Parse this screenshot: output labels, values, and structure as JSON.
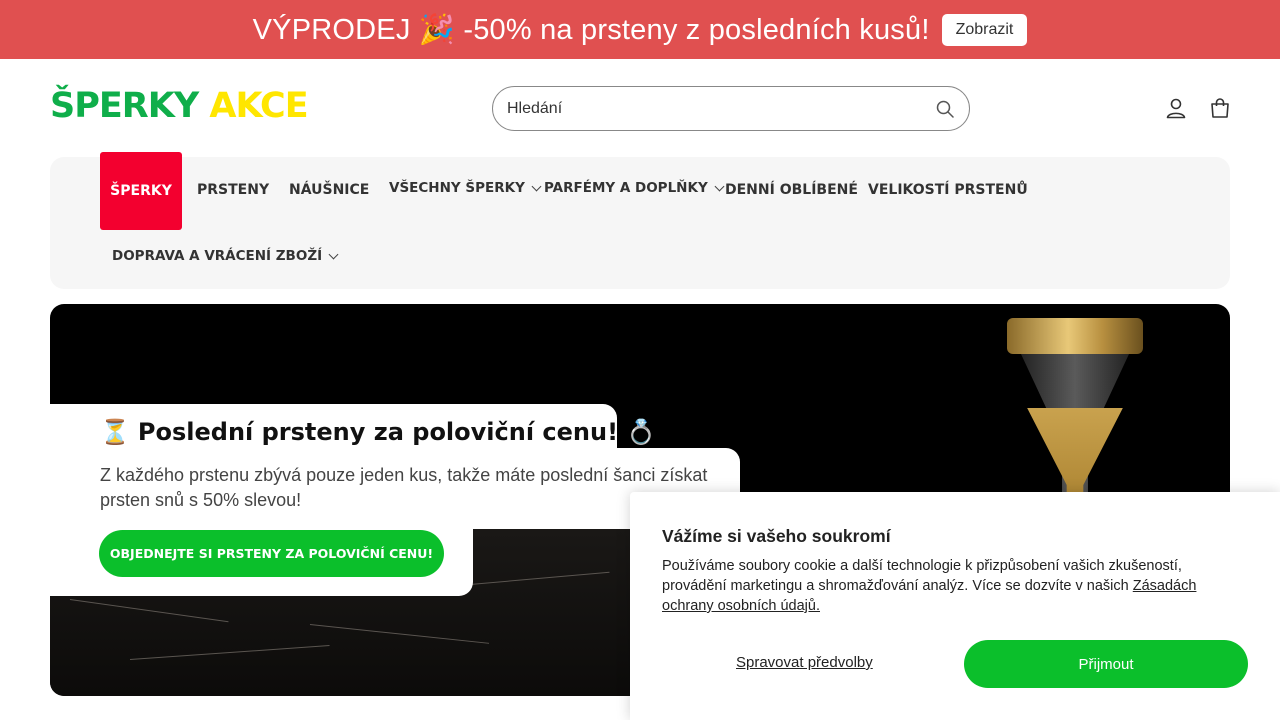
{
  "announcement": {
    "text": "VÝPRODEJ 🎉 -50% na prsteny z posledních kusů!",
    "button_label": "Zobrazit"
  },
  "logo": {
    "part1": "ŠPERKY",
    "part2": "AKCE"
  },
  "search": {
    "placeholder": "Hledání"
  },
  "header_icons": [
    "account-icon",
    "cart-icon"
  ],
  "nav": {
    "items": [
      {
        "label": "ŠPERKY",
        "active": true,
        "has_dropdown": false
      },
      {
        "label": "PRSTENY",
        "active": false,
        "has_dropdown": false
      },
      {
        "label": "NÁUŠNICE",
        "active": false,
        "has_dropdown": false
      },
      {
        "label": "VŠECHNY ŠPERKY",
        "active": false,
        "has_dropdown": true
      },
      {
        "label": "PARFÉMY A DOPLŇKY",
        "active": false,
        "has_dropdown": true
      },
      {
        "label": "DENNÍ OBLÍBENÉ",
        "active": false,
        "has_dropdown": false
      },
      {
        "label": "VELIKOSTÍ PRSTENŮ",
        "active": false,
        "has_dropdown": false
      },
      {
        "label": "DOPRAVA A VRÁCENÍ ZBOŽÍ",
        "active": false,
        "has_dropdown": true
      }
    ]
  },
  "hero": {
    "title_emoji": "⏳",
    "title": "Poslední prsteny za poloviční cenu!",
    "title_emoji_end": "💍",
    "description": "Z každého prstenu zbývá pouze jeden kus, takže máte poslední šanci získat prsten snů s 50% slevou!",
    "cta_label": "OBJEDNEJTE SI PRSTENY ZA POLOVIČNÍ CENU!"
  },
  "cookie": {
    "title": "Vážíme si vašeho soukromí",
    "body": "Používáme soubory cookie a další technologie k přizpůsobení vašich zkušeností, provádění marketingu a shromažďování analýz. Více se dozvíte v našich",
    "link_label": "Zásadách ochrany osobních údajů.",
    "manage_label": "Spravovat předvolby",
    "accept_label": "Přijmout"
  },
  "colors": {
    "announcement_bg": "#e05050",
    "logo_green": "#0fae4a",
    "logo_yellow": "#ffe600",
    "nav_active_bg": "#f3002f",
    "cta_green": "#0bbf2b"
  }
}
